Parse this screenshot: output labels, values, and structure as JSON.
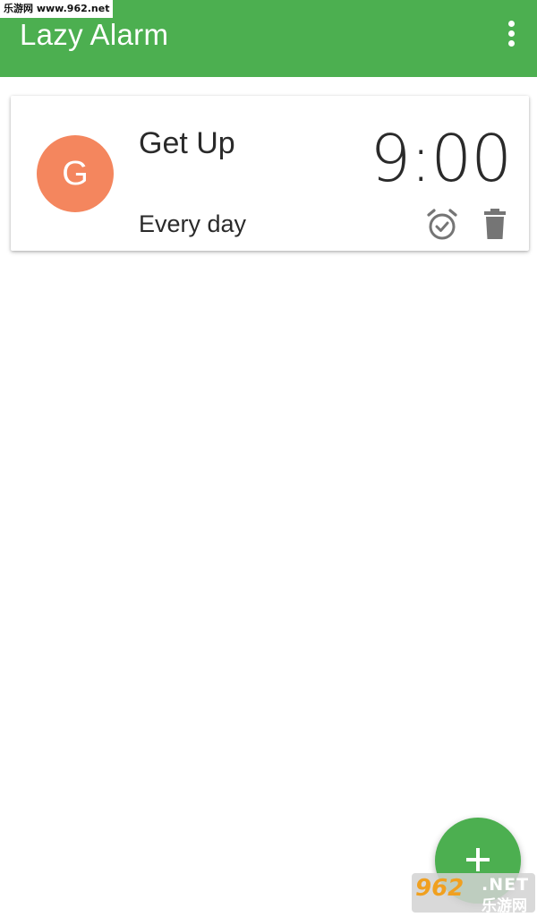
{
  "watermark": {
    "top_text": "乐游网 www.962.net",
    "bottom_number": "962",
    "bottom_net": ".NET",
    "bottom_cn": "乐游网"
  },
  "appbar": {
    "title": "Lazy Alarm",
    "menu_icon": "more-vert-icon",
    "color": "#4caf50"
  },
  "alarms": [
    {
      "initial": "G",
      "name": "Get Up",
      "time": "9:00",
      "repeat": "Every day",
      "avatar_color": "#f4865e",
      "icons": [
        "alarm-on-icon",
        "delete-icon"
      ]
    }
  ],
  "fab": {
    "icon": "add-icon",
    "color": "#4caf50"
  }
}
